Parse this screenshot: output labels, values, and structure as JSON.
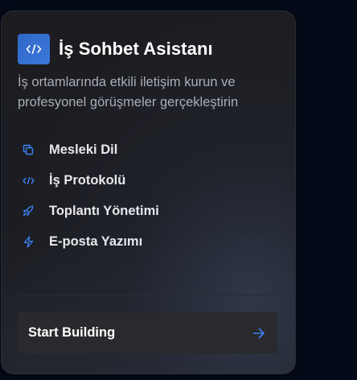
{
  "card": {
    "title": "İş Sohbet Asistanı",
    "description": "İş ortamlarında etkili iletişim kurun ve profesyonel görüşmeler gerçekleştirin",
    "logo_icon": "code-icon",
    "features": [
      {
        "label": "Mesleki Dil",
        "icon": "copy-icon"
      },
      {
        "label": "İş Protokolü",
        "icon": "code-icon"
      },
      {
        "label": "Toplantı Yönetimi",
        "icon": "rocket-icon"
      },
      {
        "label": "E-posta Yazımı",
        "icon": "lightning-icon"
      }
    ],
    "cta": {
      "label": "Start Building",
      "icon": "arrow-right-icon"
    }
  },
  "colors": {
    "page_background": "#050a18",
    "card_background": "#1c1d22",
    "accent": "#3b82f6",
    "logo_background": "#3570d0",
    "title": "#ffffff",
    "description": "#a9adb8",
    "button_background": "#2a292d"
  }
}
